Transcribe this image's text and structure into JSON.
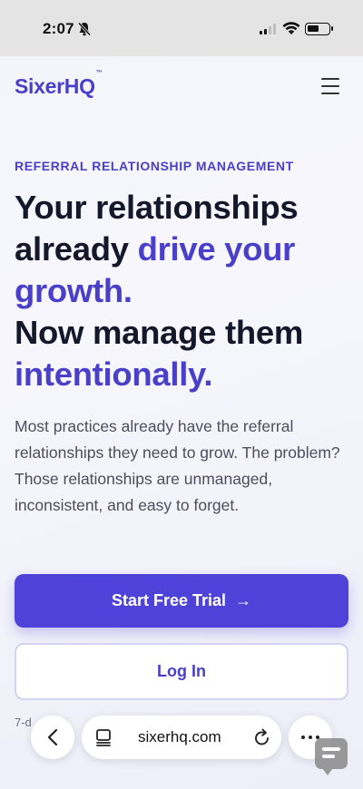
{
  "status_bar": {
    "time": "2:07"
  },
  "nav": {
    "logo": "SixerHQ",
    "logo_mark": "™"
  },
  "hero": {
    "eyebrow": "REFERRAL RELATIONSHIP MANAGEMENT",
    "headline_part1": "Your relationships already ",
    "headline_accent1": "drive your growth.",
    "headline_part2": "Now manage them ",
    "headline_accent2": "intentionally.",
    "lead": "Most practices already have the referral relationships they need to grow. The problem? Those relationships are unmanaged, inconsistent, and easy to forget.",
    "primary_cta": "Start Free Trial",
    "primary_cta_arrow": "→",
    "secondary_cta": "Log In",
    "trial_note": "7-d"
  },
  "browser": {
    "url": "sixerhq.com"
  },
  "colors": {
    "brand": "#4a3fc9",
    "primary_button": "#4e42d8"
  }
}
